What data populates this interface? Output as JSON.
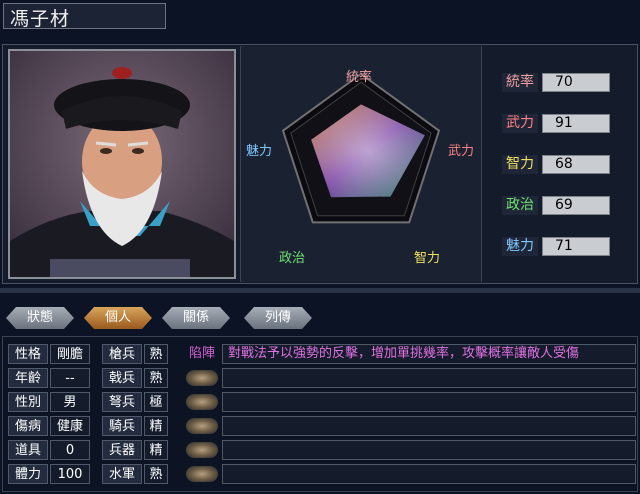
{
  "character": {
    "name": "馮子材"
  },
  "stats": [
    {
      "label": "統率",
      "value": "70",
      "color": "#f0a0a0"
    },
    {
      "label": "武力",
      "value": "91",
      "color": "#ff8080"
    },
    {
      "label": "智力",
      "value": "68",
      "color": "#f0e060"
    },
    {
      "label": "政治",
      "value": "69",
      "color": "#70e070"
    },
    {
      "label": "魅力",
      "value": "71",
      "color": "#80c8ff"
    }
  ],
  "radar_labels": {
    "top": "統率",
    "right": "武力",
    "bottom_right": "智力",
    "bottom_left": "政治",
    "left": "魅力"
  },
  "tabs": [
    {
      "label": "狀態",
      "active": false
    },
    {
      "label": "個人",
      "active": true
    },
    {
      "label": "關係",
      "active": false
    },
    {
      "label": "列傳",
      "active": false
    }
  ],
  "personal": [
    {
      "label": "性格",
      "value": "剛膽"
    },
    {
      "label": "年齡",
      "value": "--"
    },
    {
      "label": "性別",
      "value": "男"
    },
    {
      "label": "傷病",
      "value": "健康"
    },
    {
      "label": "道具",
      "value": "0"
    },
    {
      "label": "體力",
      "value": "100"
    }
  ],
  "troops": [
    {
      "label": "槍兵",
      "value": "熟"
    },
    {
      "label": "戟兵",
      "value": "熟"
    },
    {
      "label": "弩兵",
      "value": "極"
    },
    {
      "label": "騎兵",
      "value": "精"
    },
    {
      "label": "兵器",
      "value": "精"
    },
    {
      "label": "水軍",
      "value": "熟"
    }
  ],
  "skill": {
    "name": "陷陣",
    "description": "對戰法予以強勢的反擊，增加單挑幾率，攻擊概率讓敵人受傷"
  }
}
